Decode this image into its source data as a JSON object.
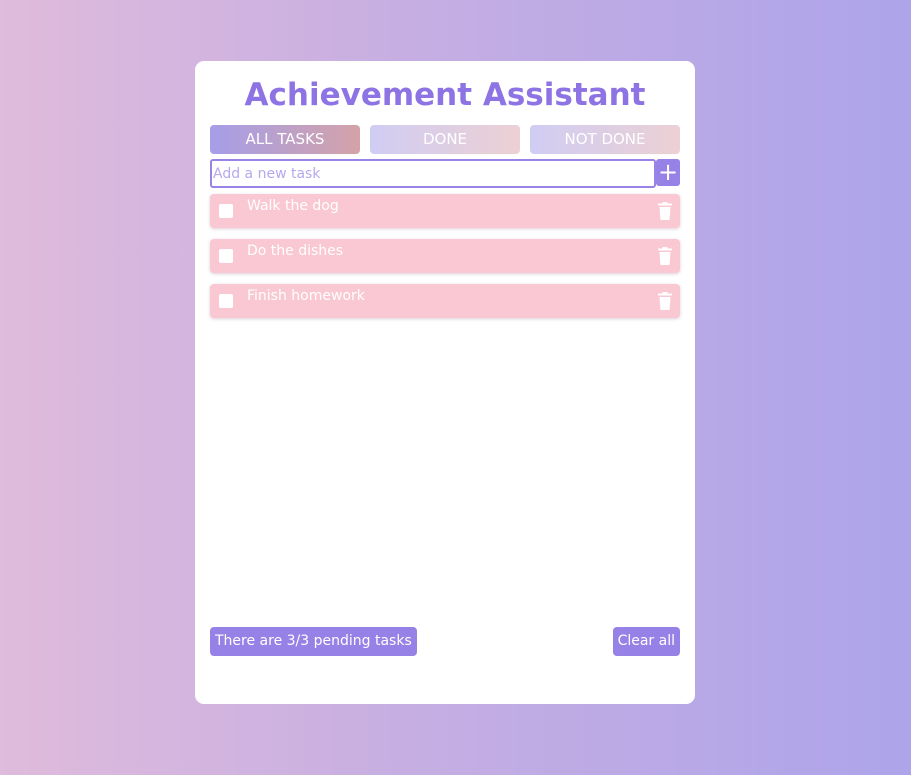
{
  "app": {
    "title": "Achievement Assistant"
  },
  "tabs": [
    {
      "label": "ALL TASKS",
      "active": true
    },
    {
      "label": "DONE",
      "active": false
    },
    {
      "label": "NOT DONE",
      "active": false
    }
  ],
  "add_task": {
    "placeholder": "Add a new task",
    "value": "",
    "button_icon": "plus-icon",
    "button_symbol": "+"
  },
  "tasks": [
    {
      "text": "Walk the dog",
      "done": false
    },
    {
      "text": "Do the dishes",
      "done": false
    },
    {
      "text": "Finish homework",
      "done": false
    }
  ],
  "footer": {
    "pending_text": "There are 3/3 pending tasks",
    "clear_label": "Clear all"
  },
  "colors": {
    "accent": "#9681e6",
    "title": "#8d73e3",
    "task_bg": "#f9c8d2"
  },
  "icons": {
    "delete": "trash-icon",
    "checkbox": "checkbox-icon"
  }
}
